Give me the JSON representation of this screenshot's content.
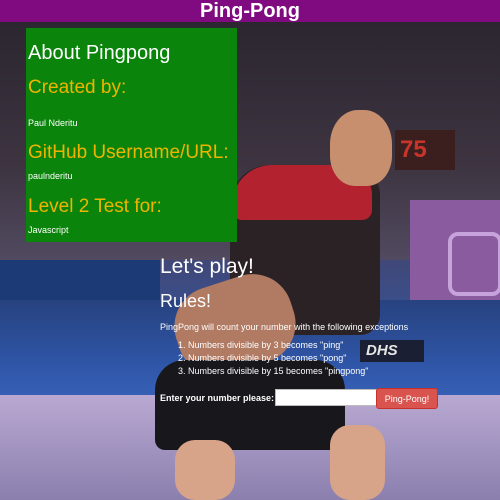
{
  "header": {
    "title": "Ping-Pong"
  },
  "about": {
    "title": "About Pingpong",
    "created_heading": "Created by:",
    "author": "Paul Nderitu",
    "github_heading": "GitHub Username/URL:",
    "github_user": "paulnderitu",
    "level_heading": "Level 2 Test for:",
    "language": "Javascript"
  },
  "play": {
    "heading": "Let's play!",
    "rules_heading": "Rules!",
    "intro": "PingPong will count your number with the following exceptions",
    "rules": [
      "Numbers divisible by 3 becomes \"ping\"",
      "Numbers divisible by 5 becomes \"pong\"",
      "Numbers divisible by 15 becomes \"pingpong\""
    ],
    "input_label": "Enter your number please:",
    "input_value": "",
    "submit_label": "Ping-Pong!"
  },
  "background": {
    "scoreboard": "75",
    "sponsor": "DHS"
  },
  "colors": {
    "titlebar": "#800a80",
    "about_panel": "#0a840a",
    "about_heading": "#f0b400",
    "button": "#d9534f"
  }
}
